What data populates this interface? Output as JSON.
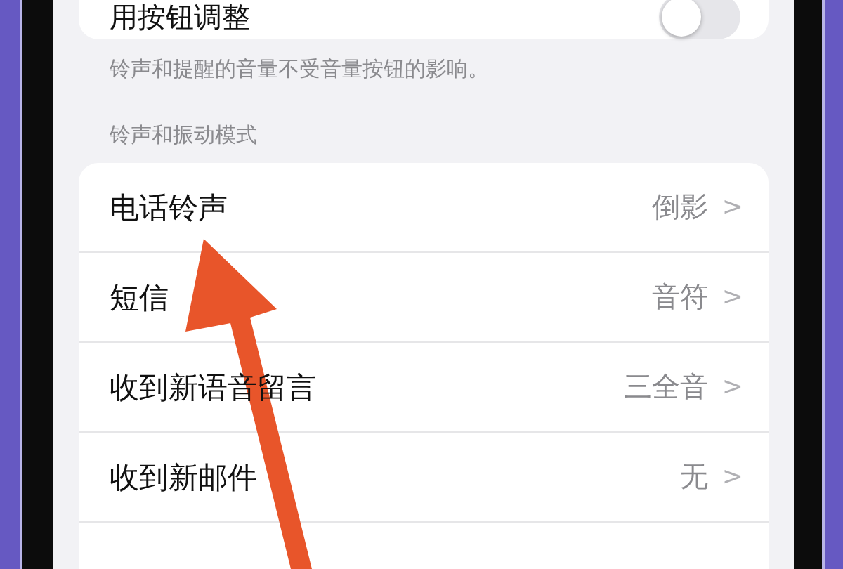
{
  "toggle_row": {
    "label": "用按钮调整",
    "on": false
  },
  "toggle_footer": "铃声和提醒的音量不受音量按钮的影响。",
  "section_header": "铃声和振动模式",
  "rows": [
    {
      "label": "电话铃声",
      "value": "倒影",
      "chevron": ">"
    },
    {
      "label": "短信",
      "value": "音符",
      "chevron": ">"
    },
    {
      "label": "收到新语音留言",
      "value": "三全音",
      "chevron": ">"
    },
    {
      "label": "收到新邮件",
      "value": "无",
      "chevron": ">"
    }
  ]
}
